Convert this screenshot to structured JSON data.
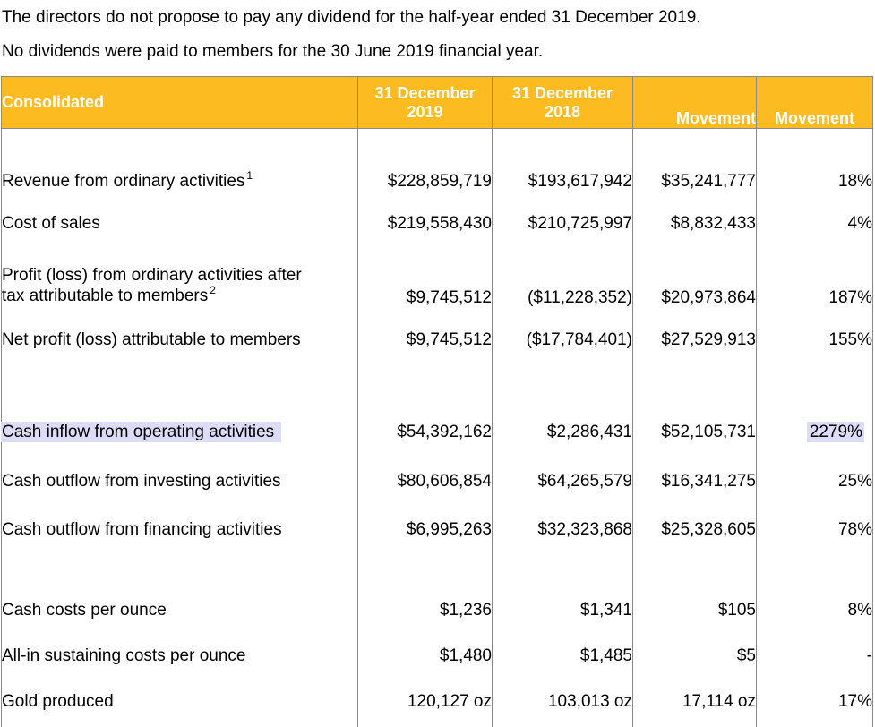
{
  "intro": {
    "line1": "The directors do not propose to pay any dividend for the half-year ended 31 December 2019.",
    "line2": "No dividends were paid to members for the 30 June 2019 financial year."
  },
  "table": {
    "headers": {
      "label": "Consolidated",
      "col1_line1": "31 December",
      "col1_line2": "2019",
      "col2_line1": "31 December",
      "col2_line2": "2018",
      "col3": "Movement",
      "col4": "Movement"
    },
    "section1": [
      {
        "label": "Revenue from ordinary activities",
        "footnote": "1",
        "v2019": "$228,859,719",
        "v2018": "$193,617,942",
        "movement": "$35,241,777",
        "pct": "18%"
      },
      {
        "label": "Cost of sales",
        "v2019": "$219,558,430",
        "v2018": "$210,725,997",
        "movement": "$8,832,433",
        "pct": "4%"
      },
      {
        "label_line1": "Profit (loss) from ordinary activities after",
        "label_line2": "tax attributable to members",
        "footnote": "2",
        "v2019": "$9,745,512",
        "v2018": "($11,228,352)",
        "movement": "$20,973,864",
        "pct": "187%"
      },
      {
        "label": "Net profit (loss) attributable to members",
        "v2019": "$9,745,512",
        "v2018": "($17,784,401)",
        "movement": "$27,529,913",
        "pct": "155%"
      }
    ],
    "section2": [
      {
        "label": "Cash inflow from operating activities",
        "v2019": "$54,392,162",
        "v2018": "$2,286,431",
        "movement": "$52,105,731",
        "pct": "2279%"
      },
      {
        "label": "Cash outflow from investing activities",
        "v2019": "$80,606,854",
        "v2018": "$64,265,579",
        "movement": "$16,341,275",
        "pct": "25%"
      },
      {
        "label": "Cash outflow from financing activities",
        "v2019": "$6,995,263",
        "v2018": "$32,323,868",
        "movement": "$25,328,605",
        "pct": "78%"
      }
    ],
    "section3": [
      {
        "label": "Cash costs per ounce",
        "v2019": "$1,236",
        "v2018": "$1,341",
        "movement": "$105",
        "pct": "8%"
      },
      {
        "label": "All-in sustaining costs per ounce",
        "v2019": "$1,480",
        "v2018": "$1,485",
        "movement": "$5",
        "pct": "-"
      },
      {
        "label": "Gold produced",
        "v2019": "120,127 oz",
        "v2018": "103,013 oz",
        "movement": "17,114 oz",
        "pct": "17%"
      }
    ]
  },
  "colors": {
    "header_bg": "#fbbb21",
    "header_text": "#ffffff",
    "highlight": "#dcdcf6"
  }
}
